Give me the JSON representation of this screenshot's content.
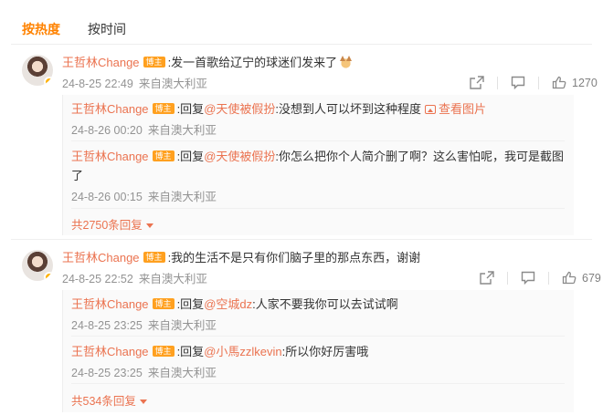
{
  "tabs": [
    {
      "label": "按热度",
      "active": true
    },
    {
      "label": "按时间",
      "active": false
    }
  ],
  "colors": {
    "accent": "#ff8200",
    "user_link": "#eb7350",
    "meta": "#939393",
    "badge": "#ffa01f"
  },
  "comments": [
    {
      "user": "王哲林Change",
      "badge": "博主",
      "text": ":发一首歌给辽宁的球迷们发来了",
      "emoji_icon": "cat-emoji-icon",
      "time": "24-8-25 22:49",
      "source": "来自澳大利亚",
      "like_count": "1270",
      "replies": [
        {
          "user": "王哲林Change",
          "badge": "博主",
          "prefix": ":回复",
          "mention": "@天使被假扮",
          "text": ":没想到人可以坏到这种程度",
          "view_image": "查看图片",
          "time": "24-8-26 00:20",
          "source": "来自澳大利亚"
        },
        {
          "user": "王哲林Change",
          "badge": "博主",
          "prefix": ":回复",
          "mention": "@天使被假扮",
          "text_line1": ":你怎么把你个人简介删了啊？这么害怕呢，我可是截图",
          "text_line2": "了",
          "time": "24-8-26 00:15",
          "source": "来自澳大利亚"
        }
      ],
      "more_replies": "共2750条回复"
    },
    {
      "user": "王哲林Change",
      "badge": "博主",
      "text": ":我的生活不是只有你们脑子里的那点东西，谢谢",
      "time": "24-8-25 22:52",
      "source": "来自澳大利亚",
      "like_count": "679",
      "replies": [
        {
          "user": "王哲林Change",
          "badge": "博主",
          "prefix": ":回复",
          "mention": "@空城dz",
          "text": ":人家不要我你可以去试试啊",
          "time": "24-8-25 23:25",
          "source": "来自澳大利亚"
        },
        {
          "user": "王哲林Change",
          "badge": "博主",
          "prefix": ":回复",
          "mention": "@小馬zzlkevin",
          "text": ":所以你好厉害哦",
          "time": "24-8-25 23:25",
          "source": "来自澳大利亚"
        }
      ],
      "more_replies": "共534条回复"
    }
  ]
}
